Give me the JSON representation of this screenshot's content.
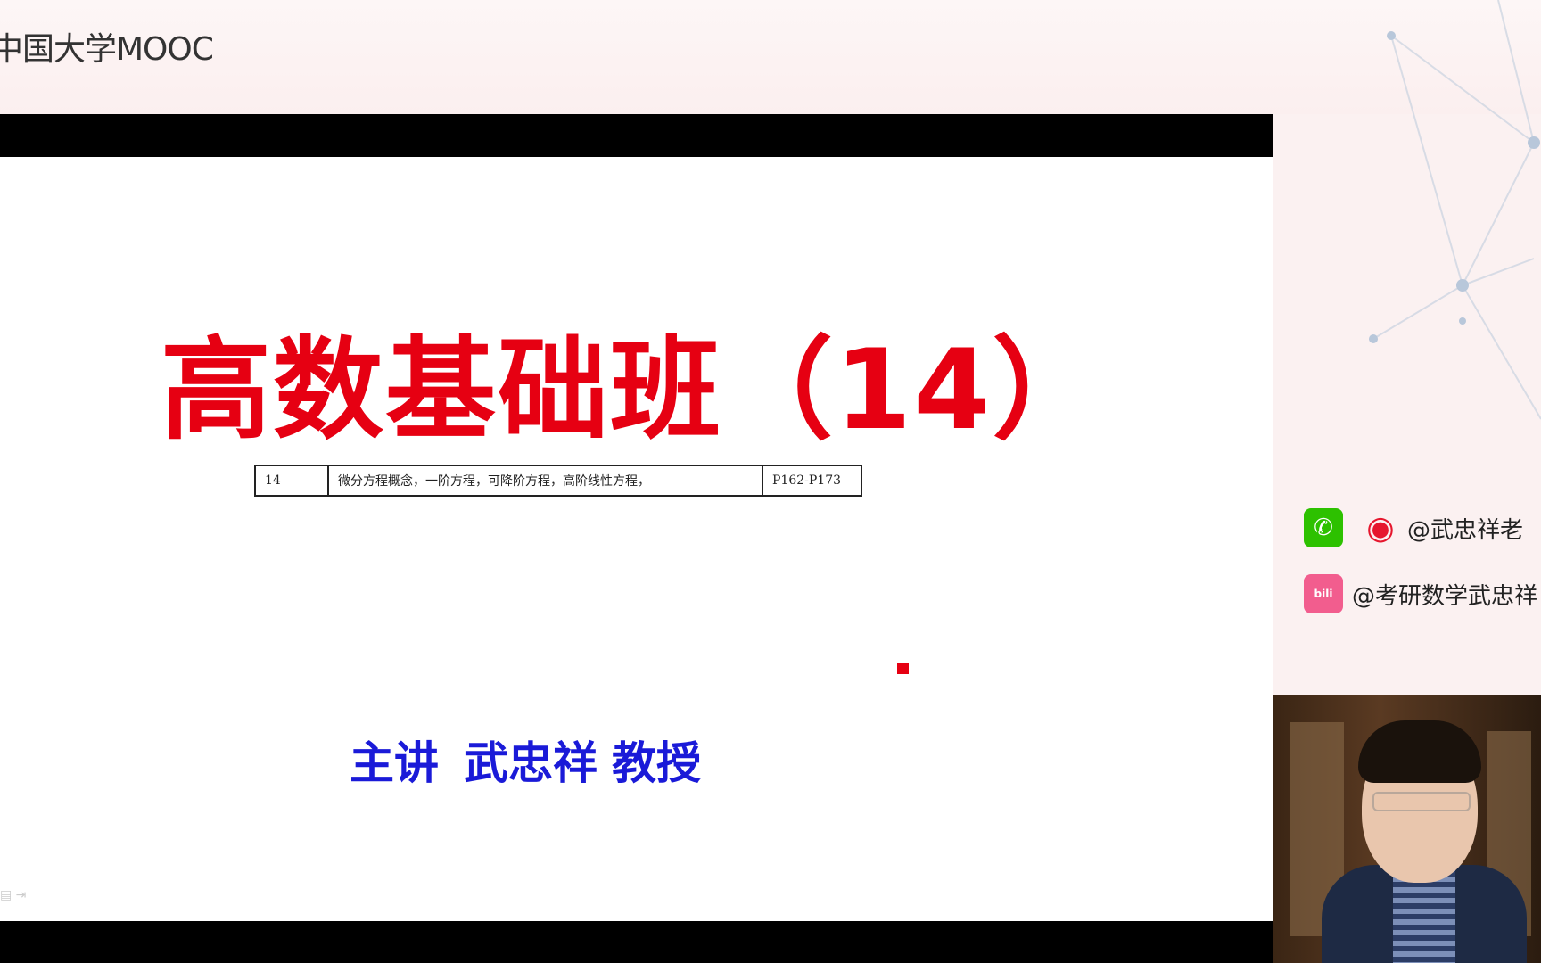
{
  "header": {
    "logo_text": "中国大学MOOC"
  },
  "slide": {
    "title": "高数基础班（14）",
    "syllabus_row": {
      "number": "14",
      "topics": "微分方程概念，一阶方程，可降阶方程，高阶线性方程，",
      "pages": "P162-P173"
    },
    "presenter": {
      "label": "主讲",
      "name": "武忠祥",
      "role": "教授"
    }
  },
  "social": {
    "weibo_handle": "@武忠祥老",
    "bilibili_handle": "@考研数学武忠祥"
  },
  "colors": {
    "title_red": "#e60012",
    "presenter_blue": "#1a1ad8",
    "wechat_green": "#2dc100",
    "bilibili_pink": "#f25d8e"
  }
}
